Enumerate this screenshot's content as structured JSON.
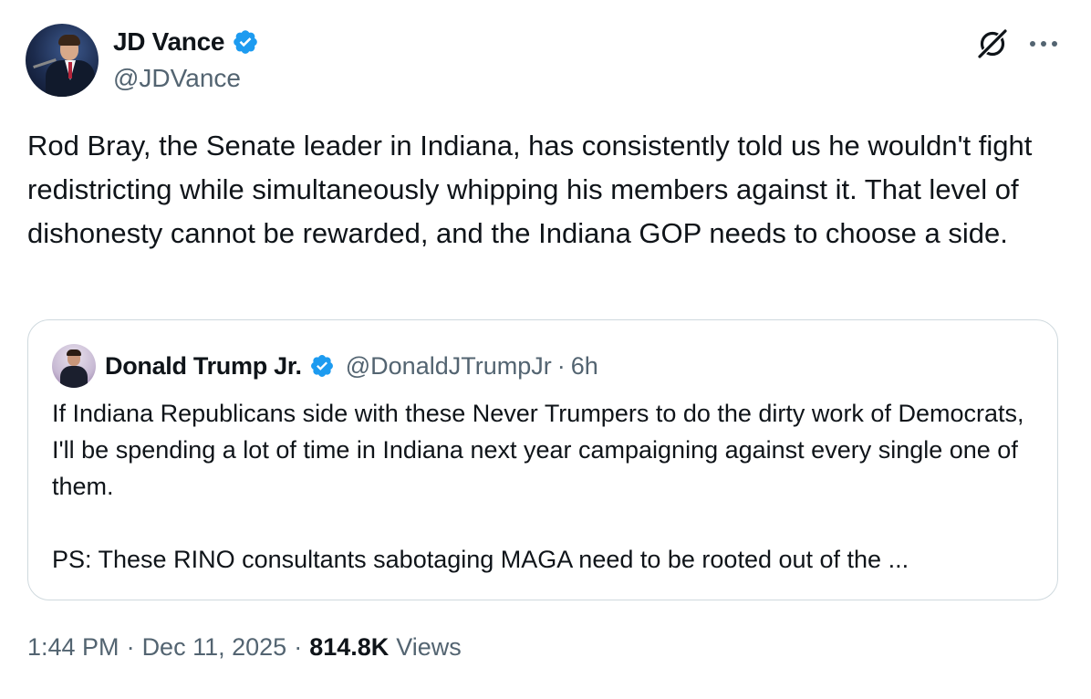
{
  "author": {
    "display_name": "JD Vance",
    "handle": "@JDVance",
    "verified": true
  },
  "tweet": {
    "text": "Rod Bray, the Senate leader in Indiana, has consistently told us he wouldn't fight redistricting while simultaneously whipping his members against it. That level of dishonesty cannot be rewarded, and the Indiana GOP needs to choose a side."
  },
  "quoted_tweet": {
    "display_name": "Donald Trump Jr.",
    "handle": "@DonaldJTrumpJr",
    "separator": "·",
    "time": "6h",
    "verified": true,
    "paragraphs": [
      "If Indiana Republicans side with these Never Trumpers to do the dirty work of Democrats, I'll be spending a lot of time in Indiana next year campaigning against every single one of them.",
      "PS: These RINO consultants sabotaging MAGA need to be rooted out of the ..."
    ]
  },
  "footer": {
    "time": "1:44 PM",
    "separator": "·",
    "date": "Dec 11, 2025",
    "views_count": "814.8K",
    "views_label": "Views"
  },
  "icons": {
    "verified_color": "#1d9bf0",
    "grok": "grok-icon",
    "more": "more-icon"
  },
  "colors": {
    "text_primary": "#0f1419",
    "text_secondary": "#536471",
    "border": "#cfd9de"
  }
}
